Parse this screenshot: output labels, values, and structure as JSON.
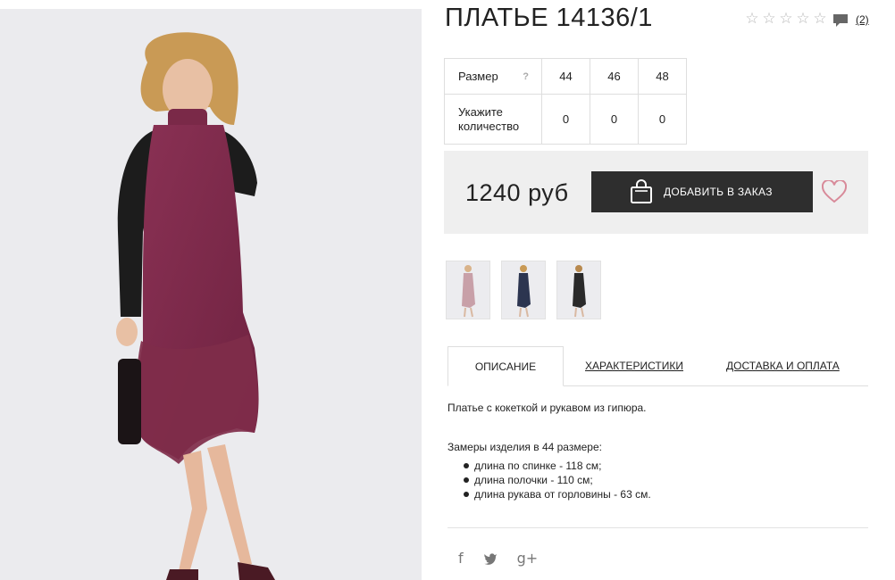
{
  "product": {
    "title": "ПЛАТЬЕ 14136/1",
    "rating_stars": 0,
    "review_count": "(2)",
    "price": "1240 руб",
    "add_to_cart_label": "ДОБАВИТЬ В ЗАКАЗ"
  },
  "sizes": {
    "size_header": "Размер",
    "help_glyph": "?",
    "qty_header": "Укажите количество",
    "items": [
      {
        "size": "44",
        "qty": "0"
      },
      {
        "size": "46",
        "qty": "0"
      },
      {
        "size": "48",
        "qty": "0"
      }
    ]
  },
  "thumbnails": [
    {
      "color": "#c8a0a8",
      "icon": "dress-photo"
    },
    {
      "color": "#2c3550",
      "icon": "dress-photo"
    },
    {
      "color": "#2a2a2a",
      "icon": "dress-photo"
    }
  ],
  "tabs": [
    {
      "label": "ОПИСАНИЕ",
      "active": true
    },
    {
      "label": "ХАРАКТЕРИСТИКИ",
      "active": false
    },
    {
      "label": "ДОСТАВКА И ОПЛАТА",
      "active": false
    }
  ],
  "description": {
    "text": "Платье с кокеткой и рукавом из гипюра.",
    "measure_title": "Замеры изделия в 44 размере:",
    "measures": [
      "длина по спинке - 118 см;",
      "длина полочки - 110 см;",
      "длина рукава от горловины - 63 см."
    ]
  },
  "social": {
    "facebook": "f",
    "twitter": "🐦",
    "googleplus": "g+"
  },
  "colors": {
    "dress": "#7d2a48",
    "button": "#2e2e2e",
    "heart": "#d88a99",
    "panel": "#efefef"
  }
}
